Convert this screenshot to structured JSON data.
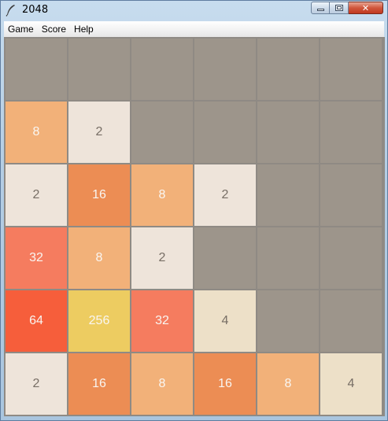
{
  "window": {
    "title": "2048",
    "controls": {
      "minimize": "minimize-icon",
      "maximize": "maximize-icon",
      "close": "✕"
    }
  },
  "menu": {
    "items": [
      {
        "label": "Game"
      },
      {
        "label": "Score"
      },
      {
        "label": "Help"
      }
    ]
  },
  "board": {
    "rows": 6,
    "cols": 6,
    "cells": [
      [
        "",
        "",
        "",
        "",
        "",
        ""
      ],
      [
        "8",
        "2",
        "",
        "",
        "",
        ""
      ],
      [
        "2",
        "16",
        "8",
        "2",
        "",
        ""
      ],
      [
        "32",
        "8",
        "2",
        "",
        "",
        ""
      ],
      [
        "64",
        "256",
        "32",
        "4",
        "",
        ""
      ],
      [
        "2",
        "16",
        "8",
        "16",
        "8",
        "4"
      ]
    ]
  },
  "colors": {
    "empty": "#9d958b",
    "2": "#eee4da",
    "4": "#ede0c8",
    "8": "#f2b179",
    "16": "#ec8d54",
    "32": "#f57c5f",
    "64": "#f65e3b",
    "256": "#edcc61",
    "text_dark": "#776e65",
    "text_light": "#f9f6f2"
  }
}
